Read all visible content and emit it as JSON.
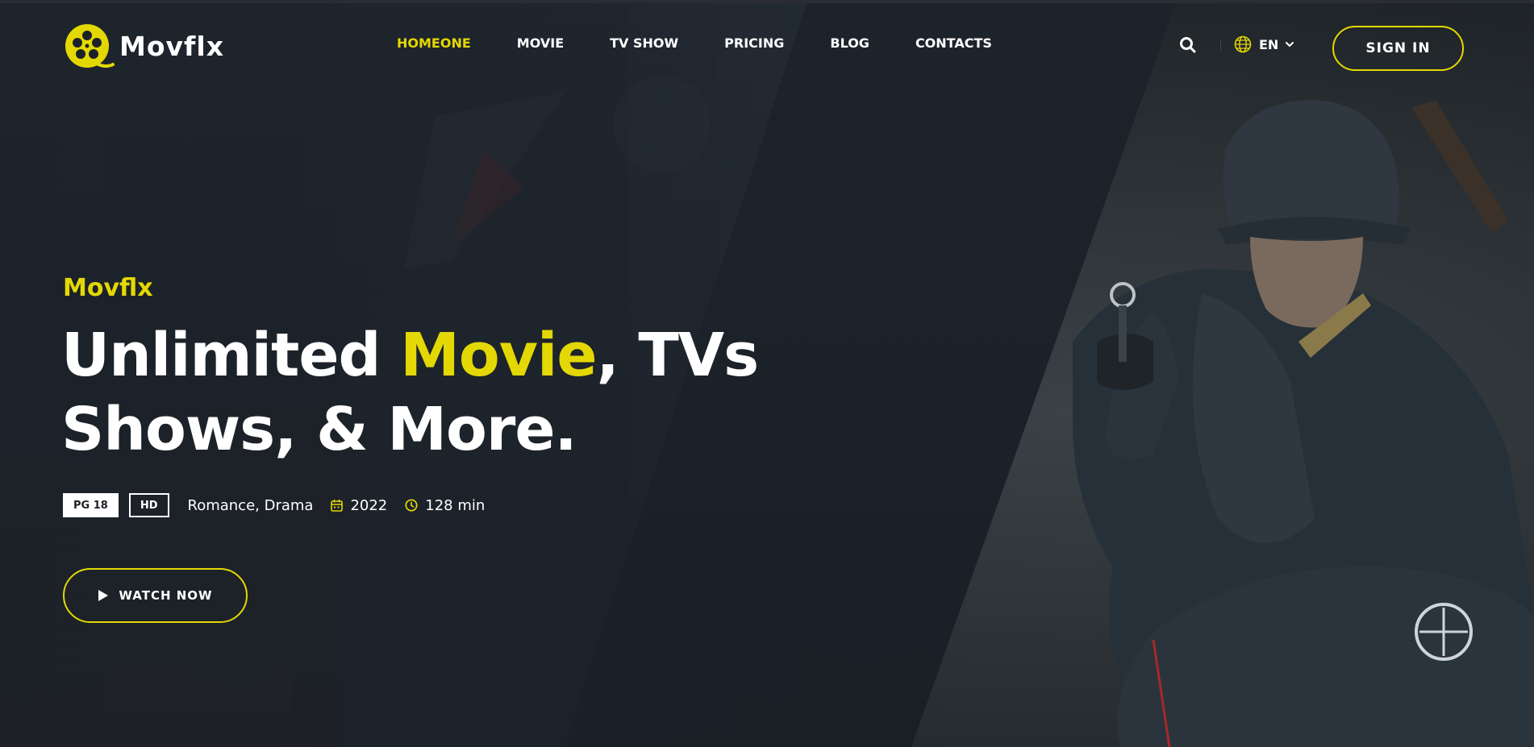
{
  "brand": {
    "name": "Movflx"
  },
  "nav": {
    "items": [
      {
        "label": "HOMEONE",
        "active": true
      },
      {
        "label": "MOVIE",
        "active": false
      },
      {
        "label": "TV SHOW",
        "active": false
      },
      {
        "label": "PRICING",
        "active": false
      },
      {
        "label": "BLOG",
        "active": false
      },
      {
        "label": "CONTACTS",
        "active": false
      }
    ]
  },
  "header": {
    "search_icon": "search-icon",
    "language": {
      "label": "EN",
      "icon": "globe-icon",
      "caret": "chevron-down-icon"
    },
    "sign_in_label": "SIGN IN"
  },
  "hero": {
    "subtitle": "Movflx",
    "title_part1": "Unlimited ",
    "title_highlight": "Movie",
    "title_part2": ", TVs",
    "title_line2": "Shows, & More.",
    "badges": {
      "rating": "PG 18",
      "quality": "HD"
    },
    "genre": "Romance, Drama",
    "year": "2022",
    "duration": "128 min",
    "watch_label": "WATCH NOW"
  },
  "colors": {
    "accent": "#e4d804",
    "background": "#1b2128",
    "text": "#ffffff"
  }
}
